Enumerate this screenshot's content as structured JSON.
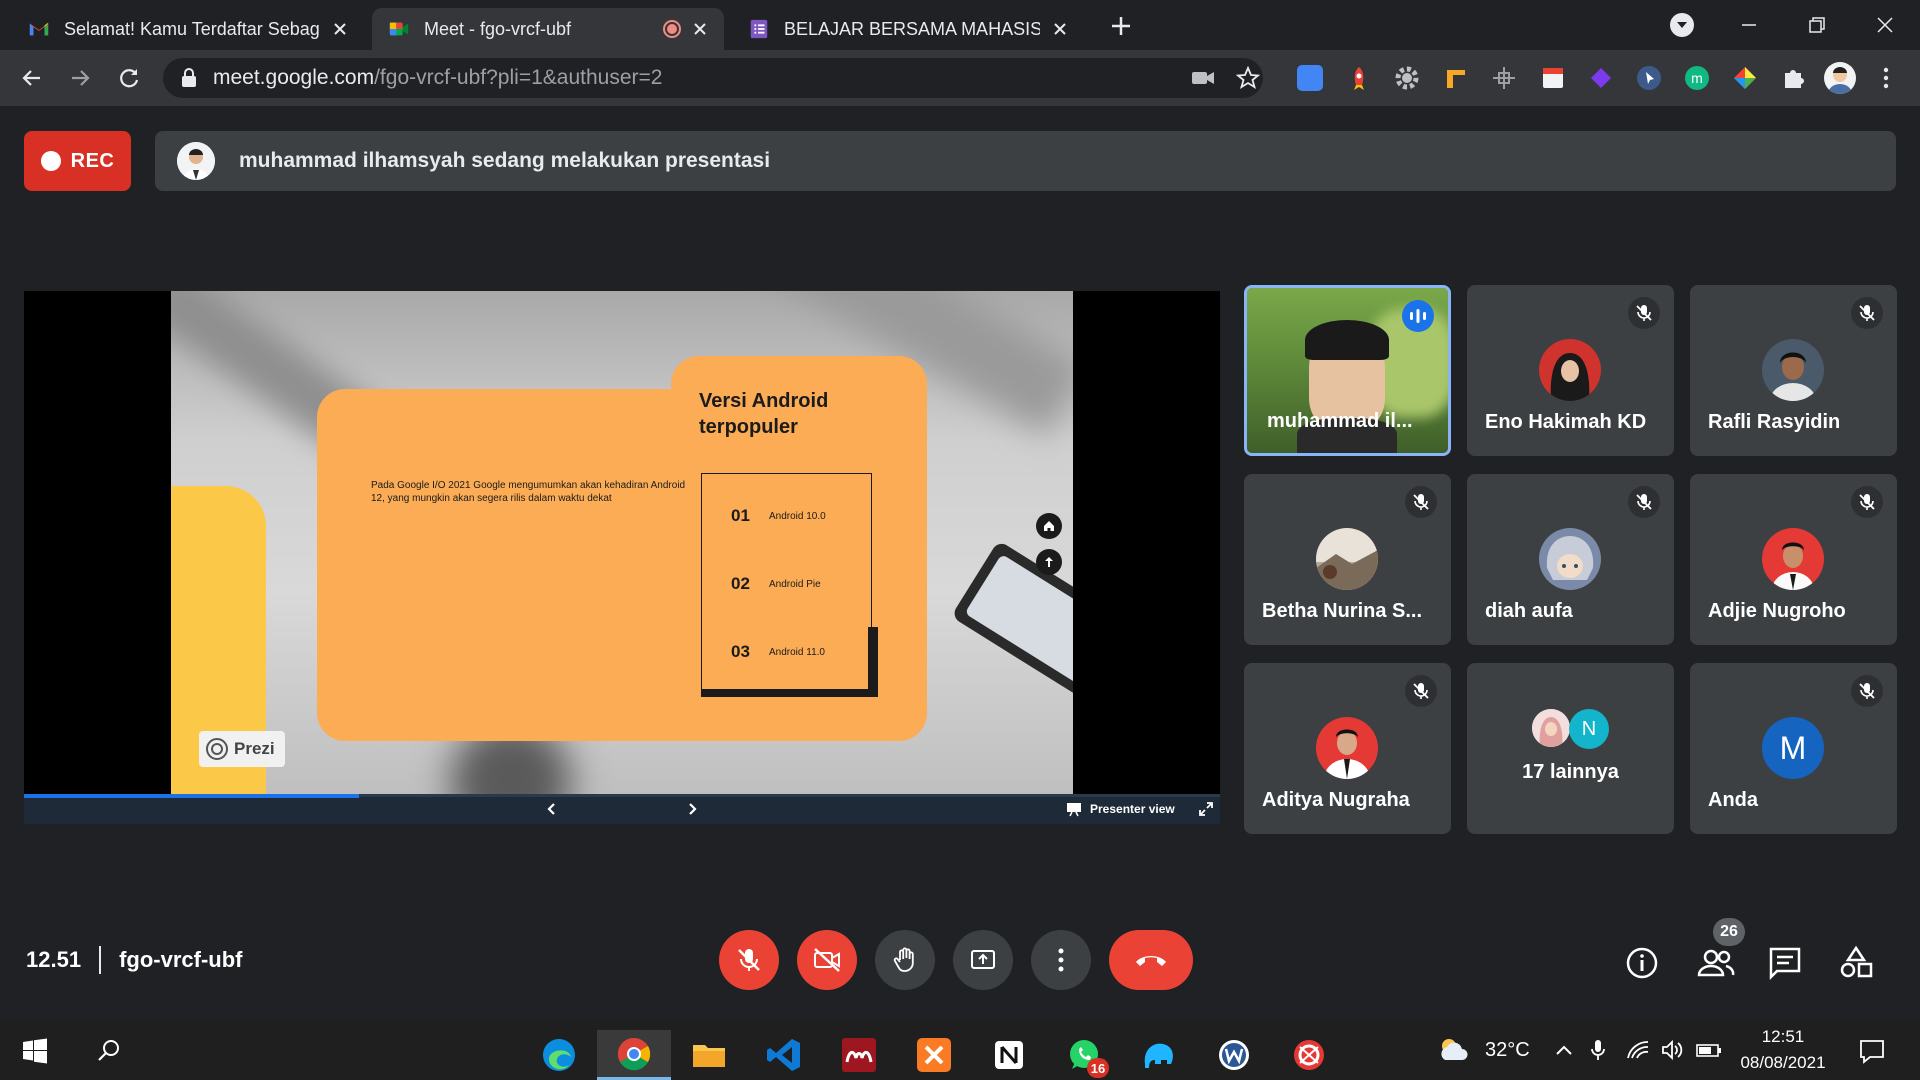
{
  "browser": {
    "tabs": [
      {
        "title": "Selamat! Kamu Terdaftar Sebagai",
        "icon": "gmail-icon",
        "active": false
      },
      {
        "title": "Meet - fgo-vrcf-ubf",
        "icon": "meet-icon",
        "active": true,
        "recording": true
      },
      {
        "title": "BELAJAR BERSAMA MAHASISWA",
        "icon": "forms-icon",
        "active": false
      }
    ],
    "url_host": "meet.google.com",
    "url_path": "/fgo-vrcf-ubf?pli=1&authuser=2"
  },
  "meet": {
    "rec_label": "REC",
    "presenting_text": "muhammad ilhamsyah sedang melakukan presentasi",
    "slide": {
      "title_line1": "Versi Android",
      "title_line2": "terpopuler",
      "body": "Pada Google I/O 2021 Google mengumumkan akan kehadiran Android 12, yang mungkin akan segera rilis dalam waktu dekat",
      "items": [
        {
          "num": "01",
          "label": "Android 10.0"
        },
        {
          "num": "02",
          "label": "Android Pie"
        },
        {
          "num": "03",
          "label": "Android 11.0"
        }
      ],
      "brand": "Prezi",
      "presenter_view": "Presenter view",
      "progress_fraction": 0.28
    },
    "participants": [
      {
        "name": "muhammad il...",
        "speaking": true
      },
      {
        "name": "Eno Hakimah KD",
        "muted": true
      },
      {
        "name": "Rafli Rasyidin",
        "muted": true
      },
      {
        "name": "Betha Nurina S...",
        "muted": true
      },
      {
        "name": "diah aufa",
        "muted": true
      },
      {
        "name": "Adjie Nugroho",
        "muted": true
      },
      {
        "name": "Aditya Nugraha",
        "muted": true
      },
      {
        "name": "17 lainnya",
        "initial": "N"
      },
      {
        "name": "Anda",
        "initial": "M",
        "muted": true
      }
    ],
    "time": "12.51",
    "meeting_code": "fgo-vrcf-ubf",
    "people_count": "26"
  },
  "taskbar": {
    "weather": "32°C",
    "clock_time": "12:51",
    "clock_date": "08/08/2021",
    "whatsapp_badge": "16"
  },
  "colors": {
    "meet_red": "#ea4335",
    "slide_orange": "#fbac55",
    "slide_yellow": "#fcc847",
    "speaking_blue": "#8ab4f8"
  }
}
